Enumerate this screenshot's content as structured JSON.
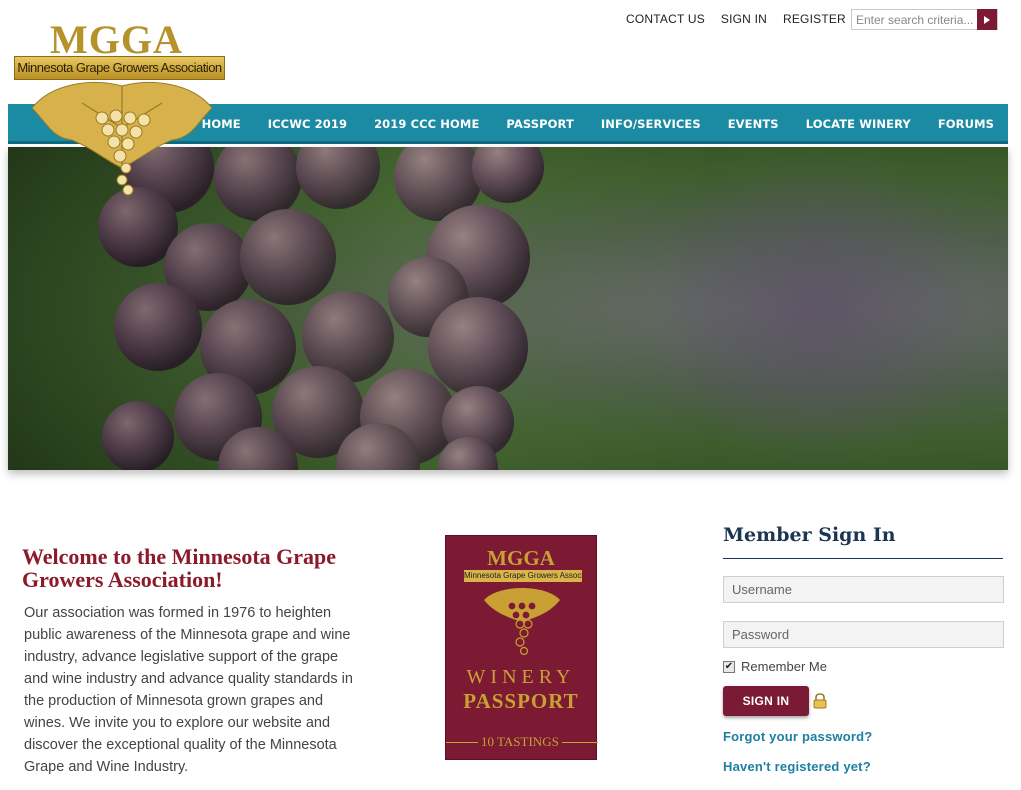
{
  "top_links": {
    "contact": "CONTACT US",
    "signin": "SIGN IN",
    "register": "REGISTER"
  },
  "search": {
    "placeholder": "Enter search criteria..."
  },
  "logo": {
    "abbr": "MGGA",
    "name": "Minnesota Grape Growers Association"
  },
  "nav": {
    "items": [
      "HOME",
      "ICCWC 2019",
      "2019 CCC HOME",
      "PASSPORT",
      "INFO/SERVICES",
      "EVENTS",
      "LOCATE WINERY",
      "FORUMS"
    ]
  },
  "welcome": {
    "title": "Welcome to the Minnesota Grape Growers  Association!",
    "text": "Our association was formed in 1976 to heighten public awareness of the Minnesota grape and wine industry, advance legislative support of the grape and wine industry and advance quality standards in the production of Minnesota grown grapes and wines. We invite you to explore our website and discover the exceptional quality of the Minnesota Grape and Wine Industry."
  },
  "passport": {
    "abbr": "MGGA",
    "band": "Minnesota Grape Growers Association",
    "line1": "WINERY",
    "line2": "PASSPORT",
    "tastings": "10 TASTINGS"
  },
  "signin": {
    "title": "Member Sign In",
    "username_placeholder": "Username",
    "password_placeholder": "Password",
    "remember": "Remember Me",
    "button": "SIGN IN",
    "forgot": "Forgot your password?",
    "register": "Haven't registered yet?"
  },
  "colors": {
    "nav": "#1b8aa3",
    "maroon": "#7a1a35",
    "gold": "#b5922a",
    "link": "#1d7fa2"
  },
  "icons": {
    "search": "play-arrow-icon",
    "lock": "lock-icon"
  }
}
